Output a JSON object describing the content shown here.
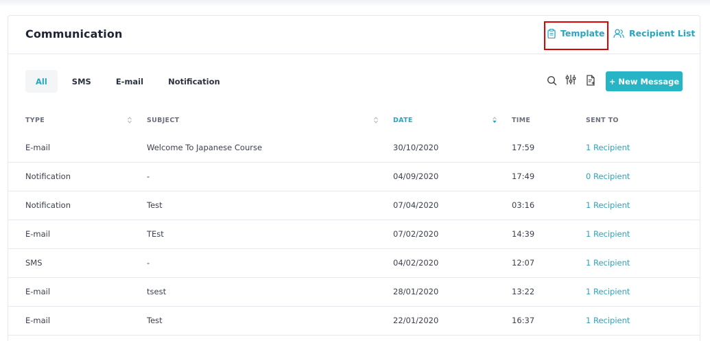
{
  "header": {
    "title": "Communication",
    "template_label": "Template",
    "recipient_list_label": "Recipient List"
  },
  "tabs": [
    {
      "label": "All",
      "active": true
    },
    {
      "label": "SMS",
      "active": false
    },
    {
      "label": "E-mail",
      "active": false
    },
    {
      "label": "Notification",
      "active": false
    }
  ],
  "toolbar": {
    "icons": [
      "search-icon",
      "filter-sliders-icon",
      "export-document-icon"
    ],
    "new_message_label": "+ New Message"
  },
  "table": {
    "columns": [
      "TYPE",
      "SUBJECT",
      "DATE",
      "TIME",
      "SENT TO"
    ],
    "sorted_column": "DATE",
    "rows": [
      {
        "type": "E-mail",
        "subject": "Welcome To Japanese Course",
        "date": "30/10/2020",
        "time": "17:59",
        "sent_to": "1 Recipient"
      },
      {
        "type": "Notification",
        "subject": "-",
        "date": "04/09/2020",
        "time": "17:49",
        "sent_to": "0 Recipient"
      },
      {
        "type": "Notification",
        "subject": "Test",
        "date": "07/04/2020",
        "time": "03:16",
        "sent_to": "1 Recipient"
      },
      {
        "type": "E-mail",
        "subject": "TEst",
        "date": "07/02/2020",
        "time": "14:39",
        "sent_to": "1 Recipient"
      },
      {
        "type": "SMS",
        "subject": "-",
        "date": "04/02/2020",
        "time": "12:07",
        "sent_to": "1 Recipient"
      },
      {
        "type": "E-mail",
        "subject": "tsest",
        "date": "28/01/2020",
        "time": "13:22",
        "sent_to": "1 Recipient"
      },
      {
        "type": "E-mail",
        "subject": "Test",
        "date": "22/01/2020",
        "time": "16:37",
        "sent_to": "1 Recipient"
      }
    ]
  },
  "colors": {
    "accent": "#2aa5bd",
    "button": "#27b4c4",
    "highlight": "#e00000"
  }
}
